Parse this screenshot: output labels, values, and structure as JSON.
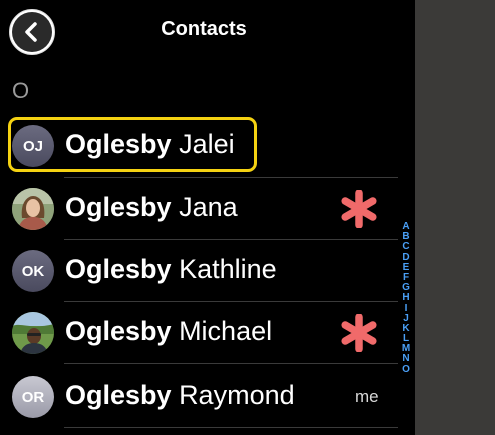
{
  "header": {
    "title": "Contacts"
  },
  "section": {
    "letter": "O"
  },
  "contacts": [
    {
      "last": "Oglesby",
      "first": "Jalei",
      "initials": "OJ",
      "avatar": "initials",
      "starred": false,
      "tag": "",
      "highlighted": true
    },
    {
      "last": "Oglesby",
      "first": "Jana",
      "initials": "",
      "avatar": "photo-woman-icon",
      "starred": true,
      "tag": ""
    },
    {
      "last": "Oglesby",
      "first": "Kathline",
      "initials": "OK",
      "avatar": "initials",
      "starred": false,
      "tag": ""
    },
    {
      "last": "Oglesby",
      "first": "Michael",
      "initials": "",
      "avatar": "photo-man-outdoor-icon",
      "starred": true,
      "tag": ""
    },
    {
      "last": "Oglesby",
      "first": "Raymond",
      "initials": "OR",
      "avatar": "initials",
      "starred": false,
      "tag": "me"
    }
  ],
  "alpha_index": [
    "A",
    "B",
    "C",
    "D",
    "E",
    "F",
    "G",
    "H",
    "I",
    "J",
    "K",
    "L",
    "M",
    "N",
    "O"
  ],
  "colors": {
    "highlight": "#f5d212",
    "favorite": "#f06a6a",
    "index": "#4a9ff5",
    "side_panel": "#3b3a38"
  }
}
